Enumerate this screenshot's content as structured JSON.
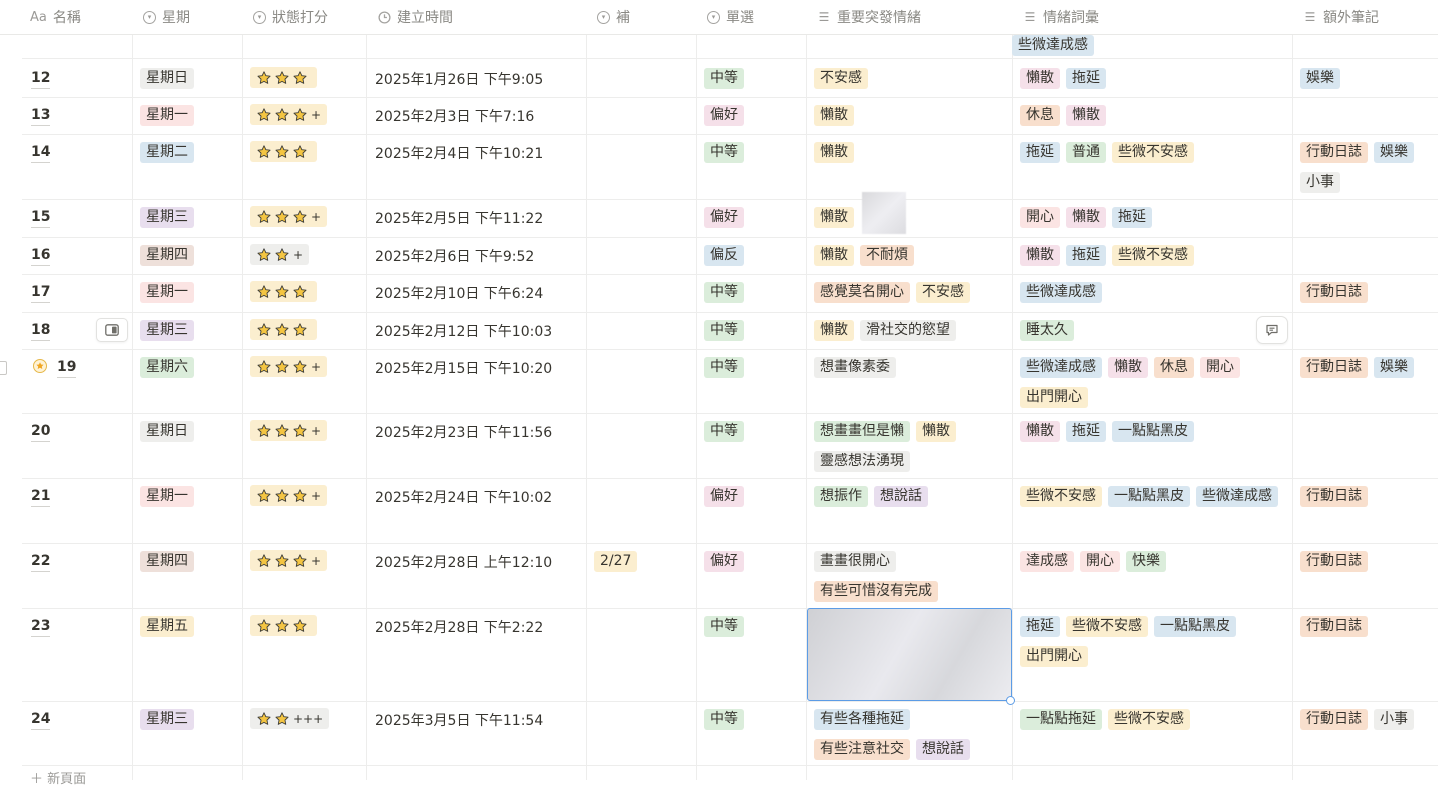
{
  "columns": [
    {
      "icon": "Aa",
      "label": "名稱"
    },
    {
      "icon": "circle",
      "label": "星期"
    },
    {
      "icon": "circle",
      "label": "狀態打分"
    },
    {
      "icon": "clock",
      "label": "建立時間"
    },
    {
      "icon": "circle",
      "label": "補"
    },
    {
      "icon": "circle",
      "label": "單選"
    },
    {
      "icon": "list",
      "label": "重要突發情緒"
    },
    {
      "icon": "list",
      "label": "情緒詞彙"
    },
    {
      "icon": "list",
      "label": "額外筆記"
    }
  ],
  "top_partial": {
    "emotion_words": [
      {
        "text": "些微達成感",
        "color": "blue"
      }
    ]
  },
  "rows": [
    {
      "num": "12",
      "weekday": {
        "text": "星期日",
        "color": "gray"
      },
      "stars": 3,
      "plus": "",
      "date": "2025年1月26日 下午9:05",
      "bu": "",
      "single": {
        "text": "中等",
        "color": "green"
      },
      "sudden": [
        {
          "text": "不安感",
          "color": "yellow"
        }
      ],
      "words": [
        {
          "text": "懶散",
          "color": "pink"
        },
        {
          "text": "拖延",
          "color": "blue"
        }
      ],
      "notes": [
        {
          "text": "娛樂",
          "color": "blue"
        }
      ]
    },
    {
      "num": "13",
      "weekday": {
        "text": "星期一",
        "color": "red"
      },
      "stars": 3,
      "plus": "+",
      "date": "2025年2月3日 下午7:16",
      "bu": "",
      "single": {
        "text": "偏好",
        "color": "pink"
      },
      "sudden": [
        {
          "text": "懶散",
          "color": "yellow"
        }
      ],
      "words": [
        {
          "text": "休息",
          "color": "orange"
        },
        {
          "text": "懶散",
          "color": "pink"
        }
      ],
      "notes": []
    },
    {
      "num": "14",
      "weekday": {
        "text": "星期二",
        "color": "blue"
      },
      "stars": 3,
      "plus": "",
      "date": "2025年2月4日 下午10:21",
      "bu": "",
      "single": {
        "text": "中等",
        "color": "green"
      },
      "sudden": [
        {
          "text": "懶散",
          "color": "yellow"
        }
      ],
      "words": [
        {
          "text": "拖延",
          "color": "blue"
        },
        {
          "text": "普通",
          "color": "green"
        },
        {
          "text": "些微不安感",
          "color": "yellow"
        }
      ],
      "notes": [
        {
          "text": "行動日誌",
          "color": "orange"
        },
        {
          "text": "娛樂",
          "color": "blue"
        },
        {
          "text": "小事",
          "color": "gray"
        }
      ]
    },
    {
      "num": "15",
      "weekday": {
        "text": "星期三",
        "color": "purple"
      },
      "stars": 3,
      "plus": "+",
      "date": "2025年2月5日 下午11:22",
      "bu": "",
      "single": {
        "text": "偏好",
        "color": "pink"
      },
      "sudden": [
        {
          "text": "懶散",
          "color": "yellow"
        }
      ],
      "words": [
        {
          "text": "開心",
          "color": "red"
        },
        {
          "text": "懶散",
          "color": "pink"
        },
        {
          "text": "拖延",
          "color": "blue"
        }
      ],
      "notes": []
    },
    {
      "num": "16",
      "weekday": {
        "text": "星期四",
        "color": "brown"
      },
      "stars": 2,
      "plus": "+",
      "date": "2025年2月6日 下午9:52",
      "bu": "",
      "single": {
        "text": "偏反",
        "color": "blue"
      },
      "sudden": [
        {
          "text": "懶散",
          "color": "yellow"
        },
        {
          "text": "不耐煩",
          "color": "orange"
        }
      ],
      "words": [
        {
          "text": "懶散",
          "color": "pink"
        },
        {
          "text": "拖延",
          "color": "blue"
        },
        {
          "text": "些微不安感",
          "color": "yellow"
        }
      ],
      "notes": []
    },
    {
      "num": "17",
      "weekday": {
        "text": "星期一",
        "color": "red"
      },
      "stars": 3,
      "plus": "",
      "date": "2025年2月10日 下午6:24",
      "bu": "",
      "single": {
        "text": "中等",
        "color": "green"
      },
      "sudden": [
        {
          "text": "感覺莫名開心",
          "color": "orange"
        },
        {
          "text": "不安感",
          "color": "yellow"
        }
      ],
      "words": [
        {
          "text": "些微達成感",
          "color": "blue"
        }
      ],
      "notes": [
        {
          "text": "行動日誌",
          "color": "orange"
        }
      ]
    },
    {
      "num": "18",
      "weekday": {
        "text": "星期三",
        "color": "purple"
      },
      "stars": 3,
      "plus": "",
      "date": "2025年2月12日 下午10:03",
      "bu": "",
      "single": {
        "text": "中等",
        "color": "green"
      },
      "sudden": [
        {
          "text": "懶散",
          "color": "yellow"
        },
        {
          "text": "滑社交的慾望",
          "color": "gray"
        }
      ],
      "words": [
        {
          "text": "睡太久",
          "color": "green"
        }
      ],
      "notes": []
    },
    {
      "num": "19",
      "weekday": {
        "text": "星期六",
        "color": "green"
      },
      "stars": 3,
      "plus": "+",
      "date": "2025年2月15日 下午10:20",
      "bu": "",
      "single": {
        "text": "中等",
        "color": "green"
      },
      "sudden": [
        {
          "text": "想畫像素委",
          "color": "gray"
        }
      ],
      "words": [
        {
          "text": "些微達成感",
          "color": "blue"
        },
        {
          "text": "懶散",
          "color": "pink"
        },
        {
          "text": "休息",
          "color": "orange"
        },
        {
          "text": "開心",
          "color": "red"
        },
        {
          "text": "出門開心",
          "color": "yellow"
        }
      ],
      "notes": [
        {
          "text": "行動日誌",
          "color": "orange"
        },
        {
          "text": "娛樂",
          "color": "blue"
        }
      ]
    },
    {
      "num": "20",
      "weekday": {
        "text": "星期日",
        "color": "gray"
      },
      "stars": 3,
      "plus": "+",
      "date": "2025年2月23日 下午11:56",
      "bu": "",
      "single": {
        "text": "中等",
        "color": "green"
      },
      "sudden": [
        {
          "text": "想畫畫但是懶",
          "color": "green"
        },
        {
          "text": "懶散",
          "color": "yellow"
        },
        {
          "text": "靈感想法湧現",
          "color": "gray"
        }
      ],
      "words": [
        {
          "text": "懶散",
          "color": "pink"
        },
        {
          "text": "拖延",
          "color": "blue"
        },
        {
          "text": "一點點黑皮",
          "color": "blue"
        }
      ],
      "notes": []
    },
    {
      "num": "21",
      "weekday": {
        "text": "星期一",
        "color": "red"
      },
      "stars": 3,
      "plus": "+",
      "date": "2025年2月24日 下午10:02",
      "bu": "",
      "single": {
        "text": "偏好",
        "color": "pink"
      },
      "sudden": [
        {
          "text": "想振作",
          "color": "green"
        },
        {
          "text": "想說話",
          "color": "purple"
        }
      ],
      "words": [
        {
          "text": "些微不安感",
          "color": "yellow"
        },
        {
          "text": "一點點黑皮",
          "color": "blue"
        },
        {
          "text": "些微達成感",
          "color": "blue"
        }
      ],
      "notes": [
        {
          "text": "行動日誌",
          "color": "orange"
        }
      ]
    },
    {
      "num": "22",
      "weekday": {
        "text": "星期四",
        "color": "brown"
      },
      "stars": 3,
      "plus": "+",
      "date": "2025年2月28日 上午12:10",
      "bu": "2/27",
      "single": {
        "text": "偏好",
        "color": "pink"
      },
      "sudden": [
        {
          "text": "畫畫很開心",
          "color": "gray"
        },
        {
          "text": "有些可惜沒有完成",
          "color": "orange"
        }
      ],
      "words": [
        {
          "text": "達成感",
          "color": "red"
        },
        {
          "text": "開心",
          "color": "red"
        },
        {
          "text": "快樂",
          "color": "green"
        }
      ],
      "notes": [
        {
          "text": "行動日誌",
          "color": "orange"
        }
      ]
    },
    {
      "num": "23",
      "weekday": {
        "text": "星期五",
        "color": "yellow"
      },
      "stars": 3,
      "plus": "",
      "date": "2025年2月28日 下午2:22",
      "bu": "",
      "single": {
        "text": "中等",
        "color": "green"
      },
      "sudden": [],
      "words": [
        {
          "text": "拖延",
          "color": "blue"
        },
        {
          "text": "些微不安感",
          "color": "yellow"
        },
        {
          "text": "一點點黑皮",
          "color": "blue"
        },
        {
          "text": "出門開心",
          "color": "yellow"
        }
      ],
      "notes": [
        {
          "text": "行動日誌",
          "color": "orange"
        }
      ]
    },
    {
      "num": "24",
      "weekday": {
        "text": "星期三",
        "color": "purple"
      },
      "stars": 2,
      "plus": "+++",
      "date": "2025年3月5日 下午11:54",
      "bu": "",
      "single": {
        "text": "中等",
        "color": "green"
      },
      "sudden": [
        {
          "text": "有些各種拖延",
          "color": "blue"
        },
        {
          "text": "有些注意社交",
          "color": "orange"
        },
        {
          "text": "想說話",
          "color": "purple"
        }
      ],
      "words": [
        {
          "text": "一點點拖延",
          "color": "green"
        },
        {
          "text": "些微不安感",
          "color": "yellow"
        }
      ],
      "notes": [
        {
          "text": "行動日誌",
          "color": "orange"
        },
        {
          "text": "小事",
          "color": "gray"
        }
      ]
    }
  ]
}
